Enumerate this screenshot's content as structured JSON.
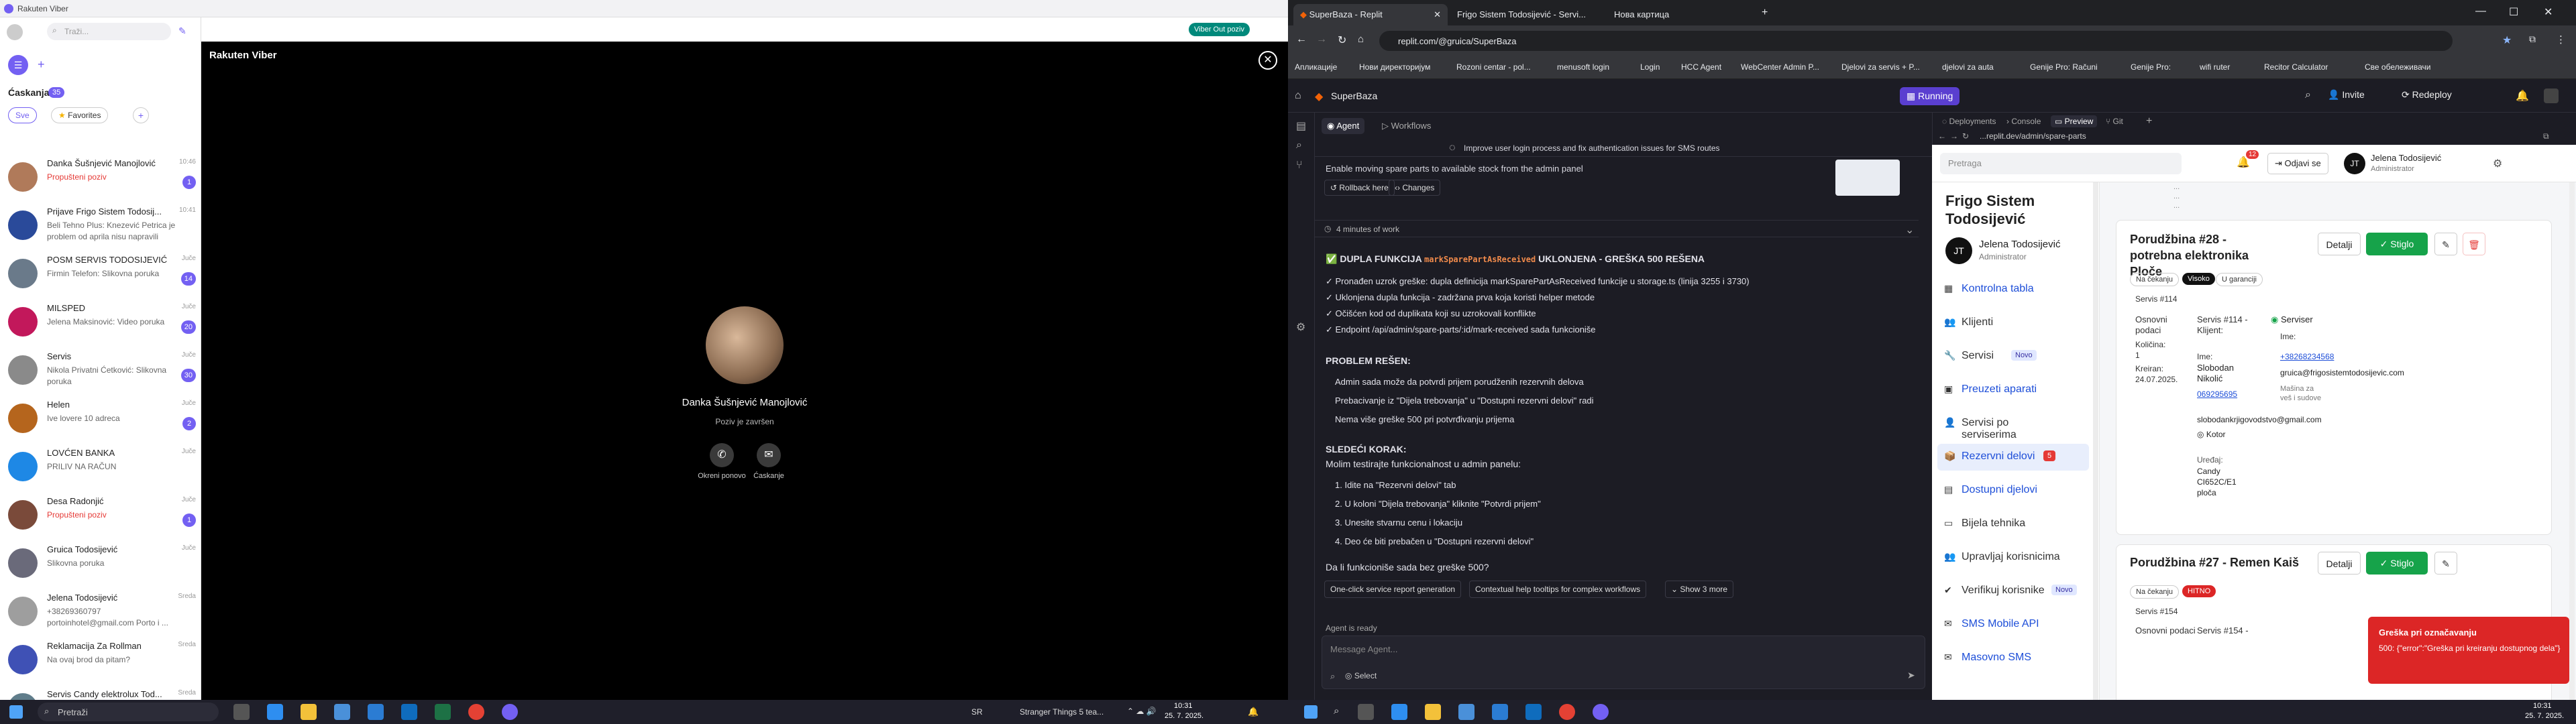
{
  "viber": {
    "app_title": "Rakuten Viber",
    "search_placeholder": "Traži...",
    "viber_out_label": "Viber Out poziv",
    "chats_label": "Ćaskanja",
    "chats_count": "35",
    "filter_all": "Sve",
    "filter_favorites": "Favorites",
    "brand": "Rakuten Viber",
    "call": {
      "name": "Danka Šušnjević Manojlović",
      "status": "Poziv je završen",
      "redial": "Okreni ponovo",
      "chat": "Ćaskanje"
    },
    "chats": [
      {
        "name": "Danka Šušnjević Manojlović",
        "preview": "Propušteni poziv",
        "time": "10:46",
        "badge": "1",
        "missed": true,
        "color": "#b07a5a"
      },
      {
        "name": "Prijave Frigo Sistem Todosij...",
        "preview": "Beli Tehno Plus: Knezević Petrica je problem od aprila nisu napravili",
        "time": "10:41",
        "badge": "",
        "missed": false,
        "color": "#2a4a9a"
      },
      {
        "name": "POSM SERVIS TODOSIJEVIĆ",
        "preview": "Firmin Telefon: Slikovna poruka",
        "time": "Juče",
        "badge": "14",
        "missed": false,
        "color": "#6a7a8a"
      },
      {
        "name": "MILSPED",
        "preview": "Jelena Maksinović: Video poruka",
        "time": "Juče",
        "badge": "20",
        "missed": false,
        "color": "#c2185b"
      },
      {
        "name": "Servis",
        "preview": "Nikola Privatni Ćetković: Slikovna poruka",
        "time": "Juče",
        "badge": "30",
        "missed": false,
        "color": "#8a8a8a"
      },
      {
        "name": "Helen",
        "preview": "Ive lovere 10 adreca",
        "time": "Juče",
        "badge": "2",
        "missed": false,
        "color": "#b5651d"
      },
      {
        "name": "LOVĆEN BANKA",
        "preview": "PRILIV NA RAČUN",
        "time": "Juče",
        "badge": "",
        "missed": false,
        "color": "#1e88e5"
      },
      {
        "name": "Desa Radonjić",
        "preview": "Propušteni poziv",
        "time": "Juče",
        "badge": "1",
        "missed": true,
        "color": "#7a4a3a"
      },
      {
        "name": "Gruica Todosijević",
        "preview": "Slikovna poruka",
        "time": "Juče",
        "badge": "",
        "missed": false,
        "color": "#6a6a7a"
      },
      {
        "name": "Jelena Todosijević",
        "preview": "+38269360797 portoinhotel@gmail.com Porto i ...",
        "time": "Sreda",
        "badge": "",
        "missed": false,
        "color": "#9e9e9e"
      },
      {
        "name": "Reklamacija Za Rollman",
        "preview": "Na ovaj brod da pitam?",
        "time": "Sreda",
        "badge": "",
        "missed": false,
        "color": "#3f51b5"
      },
      {
        "name": "Servis Candy elektrolux Tod...",
        "preview": "",
        "time": "Sreda",
        "badge": "",
        "missed": false,
        "color": "#607d8b"
      }
    ]
  },
  "taskbar_left": {
    "search_placeholder": "Pretraži",
    "time": "10:31",
    "date": "25. 7. 2025.",
    "media": "Stranger Things 5 tea...",
    "weather": "SR"
  },
  "taskbar_right": {
    "time": "10:31",
    "date": "25. 7. 2025."
  },
  "browser": {
    "tabs": [
      "SuperBaza - Replit",
      "Frigo Sistem Todosijević - Servi...",
      "Нова картица"
    ],
    "url": "replit.com/@gruica/SuperBaza",
    "bookmarks": [
      "Апликације",
      "Нови директоријум",
      "Rozoni centar - pol...",
      "menusoft login",
      "Login",
      "HCC Agent",
      "WebCenter Admin P...",
      "Djelovi za servis + P...",
      "djelovi za auta",
      "Genije Pro: Računi",
      "Genije Pro:",
      "wifi ruter",
      "Recitor Calculator",
      "Све обележивачи"
    ]
  },
  "replit": {
    "project": "SuperBaza",
    "run_status": "Running",
    "invite": "Invite",
    "redeploy": "Redeploy",
    "agent_tabs": [
      "Agent",
      "Workflows"
    ],
    "pane_tabs": [
      "Deployments",
      "Console",
      "Preview",
      "Git"
    ],
    "task_title": "Improve user login process and fix authentication issues for SMS routes",
    "checkpoint_text": "Enable moving spare parts to available stock from the admin panel",
    "rollback": "Rollback here",
    "changes": "Changes",
    "work_time": "4 minutes of work",
    "heading_pre": "DUPLA FUNKCIJA",
    "heading_code": "markSparePartAsReceived",
    "heading_post": "UKLONJENA - GREŠKA 500 REŠENA",
    "fix_lines": [
      "✓ Pronađen uzrok greške: dupla definicija markSparePartAsReceived funkcije u storage.ts (linija 3255 i 3730)",
      "✓ Uklonjena dupla funkcija - zadržana prva koja koristi helper metode",
      "✓ Očišćen kod od duplikata koji su uzrokovali konflikte",
      "✓ Endpoint /api/admin/spare-parts/:id/mark-received sada funkcioniše"
    ],
    "solved_title": "PROBLEM REŠEN:",
    "solved_items": [
      "Admin sada može da potvrdi prijem porudženih rezervnih delova",
      "Prebacivanje iz \"Dijela trebovanja\" u \"Dostupni rezervni delovi\" radi",
      "Nema više greške 500 pri potvrđivanju prijema"
    ],
    "next_title": "SLEDEĆI KORAK:",
    "next_intro": "Molim testirajte funkcionalnost u admin panelu:",
    "steps": [
      "1. Idite na \"Rezervni delovi\" tab",
      "2. U koloni \"Dijela trebovanja\" kliknite \"Potvrdi prijem\"",
      "3. Unesite stvarnu cenu i lokaciju",
      "4. Deo će biti prebačen u \"Dostupni rezervni delovi\""
    ],
    "question": "Da li funkcioniše sada bez greške 500?",
    "suggestions": [
      "One-click service report generation",
      "Contextual help tooltips for complex workflows",
      "Show 3 more"
    ],
    "agent_ready": "Agent is ready",
    "message_placeholder": "Message Agent...",
    "select_label": "Select"
  },
  "preview": {
    "url": "...replit.dev/admin/spare-parts",
    "search_placeholder": "Pretraga",
    "notif_count": "12",
    "logout": "Odjavi se",
    "user_name": "Jelena Todosijević",
    "user_role": "Administrator",
    "brand": "Frigo Sistem Todosijević",
    "nav": [
      "Kontrolna tabla",
      "Klijenti",
      "Servisi",
      "Preuzeti aparati",
      "Servisi po serviserima",
      "Rezervni delovi",
      "Dostupni djelovi",
      "Bijela tehnika",
      "Upravljaj korisnicima",
      "Verifikuj korisnike",
      "SMS Mobile API",
      "Masovno SMS"
    ],
    "nav_badge_new": "Novo",
    "nav_badge_count": "5",
    "order28": {
      "title": "Porudžbina #28 - potrebna elektronika Ploče",
      "details": "Detalji",
      "arrived": "Stiglo",
      "status": "Na čekanju",
      "priority": "Visoko",
      "warranty": "U garanciji",
      "service": "Servis #114",
      "ordered_label": "Osnovni podaci",
      "qty_label": "Količina:",
      "qty": "1",
      "created_label": "Kreiran:",
      "created": "24.07.2025.",
      "client_label": "Servis #114 - Klijent:",
      "client_name_label": "Ime:",
      "client_name": "Slobodan Nikolić",
      "client_phone": "069295695",
      "client_email": "slobodankrjigovodstvo@gmail.com",
      "client_city": "Kotor",
      "device_label": "Uređaj:",
      "device": "Candy CI652C/E1 ploča",
      "tech_label": "Serviser",
      "tech_name_label": "Ime:",
      "tech_phone": "+38268234568",
      "tech_email": "gruica@frigosistemtodosijevic.com",
      "machine": "Mašina za veš i sudove"
    },
    "order27": {
      "title": "Porudžbina #27 - Remen Kaiš",
      "details": "Detalji",
      "arrived": "Stiglo",
      "status": "Na čekanju",
      "priority": "HITNO",
      "service": "Servis #154",
      "basic": "Osnovni podaci",
      "service_label": "Servis #154 -"
    },
    "toast": {
      "title": "Greška pri označavanju",
      "message": "500: {\"error\":\"Greška pri kreiranju dostupnog dela\"}"
    }
  }
}
